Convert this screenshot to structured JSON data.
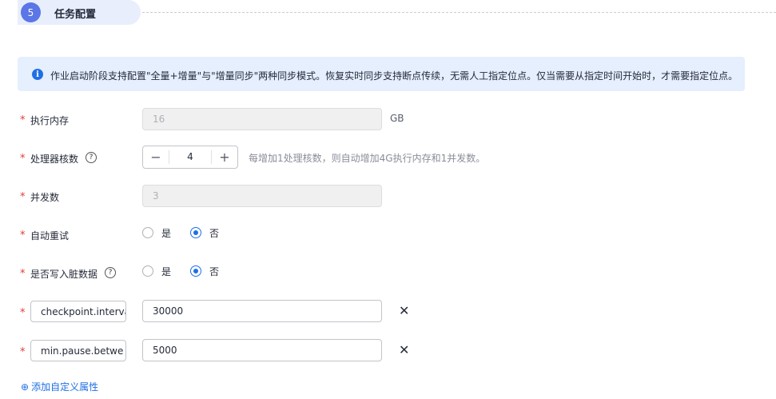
{
  "step": {
    "number": "5",
    "title": "任务配置"
  },
  "banner": {
    "icon": "info-icon",
    "text": "作业启动阶段支持配置\"全量+增量\"与\"增量同步\"两种同步模式。恢复实时同步支持断点传续，无需人工指定位点。仅当需要从指定时间开始时，才需要指定位点。"
  },
  "required_mark": "*",
  "memory": {
    "label": "执行内存",
    "value": "16",
    "unit": "GB"
  },
  "cores": {
    "label": "处理器核数",
    "help": "?",
    "minus": "−",
    "value": "4",
    "plus": "+",
    "hint": "每增加1处理核数，则自动增加4G执行内存和1并发数。"
  },
  "concurrency": {
    "label": "并发数",
    "value": "3"
  },
  "auto_retry": {
    "label": "自动重试",
    "yes": "是",
    "no": "否",
    "selected": "no"
  },
  "dirty_data": {
    "label": "是否写入脏数据",
    "help": "?",
    "yes": "是",
    "no": "否",
    "selected": "no"
  },
  "custom_props": [
    {
      "key": "checkpoint.interva",
      "value": "30000",
      "remove": "✕"
    },
    {
      "key": "min.pause.betwe",
      "value": "5000",
      "remove": "✕"
    }
  ],
  "add_property": {
    "icon": "⊕",
    "label": "添加自定义属性"
  },
  "colors": {
    "accent": "#1f6fe5",
    "required": "#e53935",
    "banner_bg": "#e5effe",
    "step": "#5b76e6"
  }
}
